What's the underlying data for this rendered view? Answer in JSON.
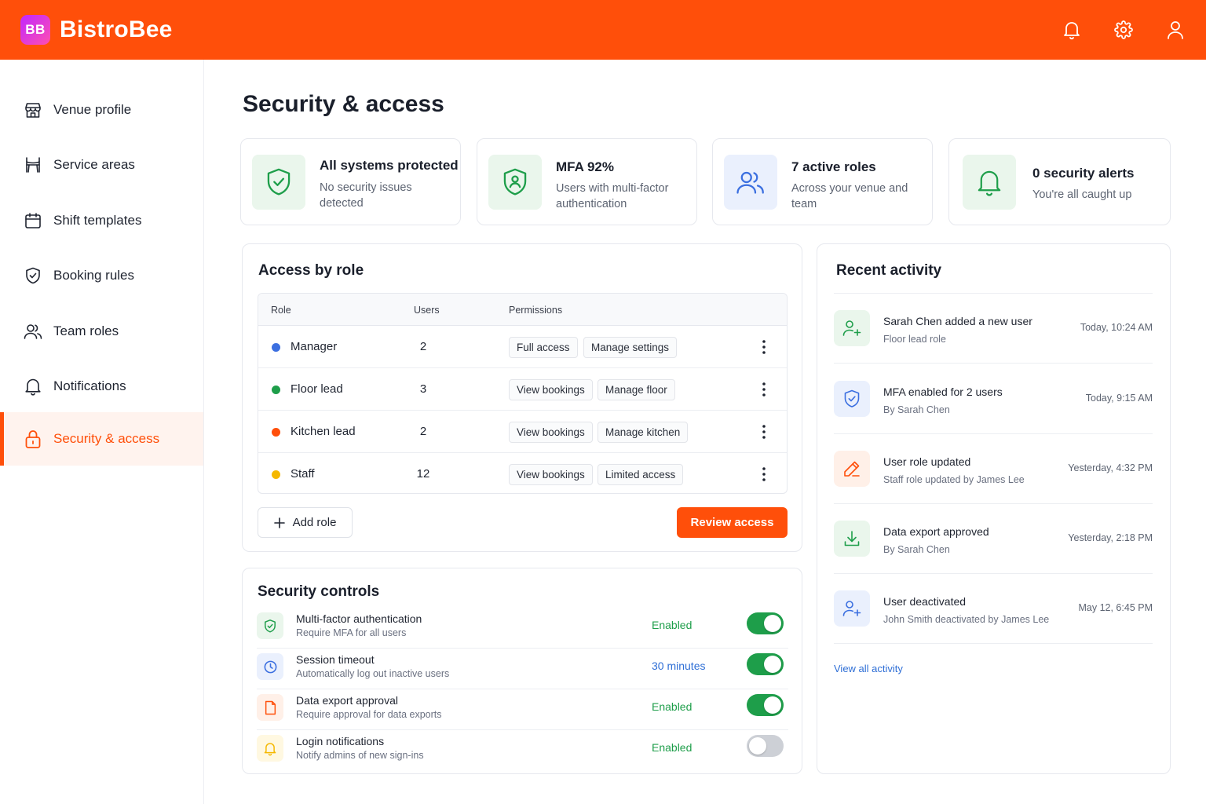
{
  "app": {
    "logo_text": "BB",
    "brand": "BistroBee"
  },
  "header": {
    "icons": [
      "bell-icon",
      "gear-icon",
      "user-icon"
    ]
  },
  "sidebar": {
    "items": [
      {
        "label": "Venue profile",
        "icon": "store-icon"
      },
      {
        "label": "Service areas",
        "icon": "chair-icon"
      },
      {
        "label": "Shift templates",
        "icon": "calendar-icon"
      },
      {
        "label": "Booking rules",
        "icon": "shield-check-icon"
      },
      {
        "label": "Team roles",
        "icon": "users-icon"
      },
      {
        "label": "Notifications",
        "icon": "bell-icon"
      },
      {
        "label": "Security & access",
        "icon": "lock-icon",
        "active": true
      }
    ]
  },
  "page": {
    "title": "Security & access"
  },
  "stats": [
    {
      "title": "All systems protected",
      "sub": "No security issues detected",
      "icon": "shield-check-icon"
    },
    {
      "title": "MFA 92%",
      "sub": "Users with multi-factor authentication",
      "icon": "shield-user-icon"
    },
    {
      "title": "7 active roles",
      "sub": "Across your venue and team",
      "icon": "users-icon"
    },
    {
      "title": "0 security alerts",
      "sub": "You're all caught up",
      "icon": "bell-icon"
    }
  ],
  "access": {
    "title": "Access by role",
    "columns": [
      "Role",
      "Users",
      "Permissions"
    ],
    "rows": [
      {
        "role": "Manager",
        "users": "2",
        "color": "#3b6fe0",
        "perms": [
          "Full access",
          "Manage settings"
        ]
      },
      {
        "role": "Floor lead",
        "users": "3",
        "color": "#1e9e4a",
        "perms": [
          "View bookings",
          "Manage floor"
        ]
      },
      {
        "role": "Kitchen lead",
        "users": "2",
        "color": "#ff4f0a",
        "perms": [
          "View bookings",
          "Manage kitchen"
        ]
      },
      {
        "role": "Staff",
        "users": "12",
        "color": "#f5b800",
        "perms": [
          "View bookings",
          "Limited access"
        ]
      }
    ],
    "add_label": "Add role",
    "review_label": "Review access"
  },
  "controls": {
    "title": "Security controls",
    "items": [
      {
        "title": "Multi-factor authentication",
        "sub": "Require MFA for all users",
        "value": "Enabled",
        "value_color": "#1e9e4a",
        "on": true,
        "icon": "shield-check-icon"
      },
      {
        "title": "Session timeout",
        "sub": "Automatically log out inactive users",
        "value": "30 minutes",
        "value_color": "#2f6fd6",
        "on": true,
        "icon": "clock-icon"
      },
      {
        "title": "Data export approval",
        "sub": "Require approval for data exports",
        "value": "Enabled",
        "value_color": "#1e9e4a",
        "on": true,
        "icon": "file-icon"
      },
      {
        "title": "Login notifications",
        "sub": "Notify admins of new sign-ins",
        "value": "Enabled",
        "value_color": "#1e9e4a",
        "on": false,
        "icon": "bell-icon"
      }
    ]
  },
  "activity": {
    "title": "Recent activity",
    "items": [
      {
        "title": "Sarah Chen added a new user",
        "sub": "Floor lead role",
        "time": "Today, 10:24 AM",
        "icon": "user-plus-icon"
      },
      {
        "title": "MFA enabled for 2 users",
        "sub": "By Sarah Chen",
        "time": "Today, 9:15 AM",
        "icon": "shield-check-icon"
      },
      {
        "title": "User role updated",
        "sub": "Staff role updated by James Lee",
        "time": "Yesterday, 4:32 PM",
        "icon": "pencil-icon"
      },
      {
        "title": "Data export approved",
        "sub": "By Sarah Chen",
        "time": "Yesterday, 2:18 PM",
        "icon": "download-icon"
      },
      {
        "title": "User deactivated",
        "sub": "John Smith deactivated by James Lee",
        "time": "May 12, 6:45 PM",
        "icon": "user-plus-icon"
      }
    ],
    "view_all": "View all activity"
  }
}
